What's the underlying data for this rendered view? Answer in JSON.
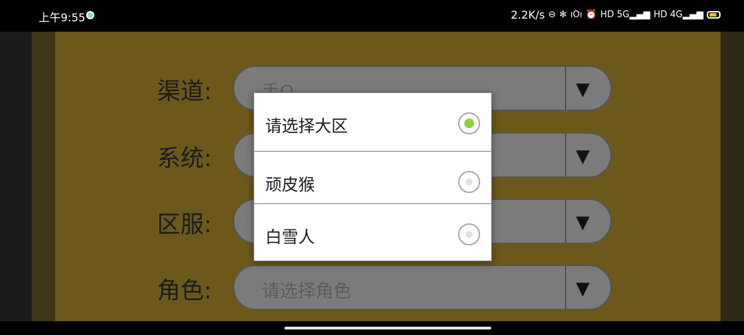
{
  "status_bar": {
    "time": "上午9:55",
    "net_speed": "2.2K/s",
    "icons": [
      "dnd-icon",
      "bluetooth-icon",
      "vibrate-icon",
      "alarm-icon",
      "hd-5g-signal-icon",
      "hd-4g-signal-icon",
      "battery-icon"
    ],
    "icon_glyphs": {
      "dnd": "⊖",
      "bluetooth": "✻",
      "vibrate": "ıOı",
      "alarm": "⏰",
      "sig1": "HD 5G▂▄▆",
      "sig2": "HD 4G▂▄▆"
    },
    "battery_color": "#f2c200"
  },
  "form": {
    "rows": [
      {
        "label": "渠道:",
        "value": "手Q"
      },
      {
        "label": "系统:",
        "value": ""
      },
      {
        "label": "区服:",
        "value": ""
      },
      {
        "label": "角色:",
        "value": "请选择角色"
      }
    ],
    "arrow_glyph": "▼"
  },
  "dialog": {
    "options": [
      {
        "label": "请选择大区",
        "checked": true
      },
      {
        "label": "顽皮猴",
        "checked": false
      },
      {
        "label": "白雪人",
        "checked": false
      }
    ],
    "checked_color": "#8bd43c"
  },
  "colors": {
    "panel": "#6d581b",
    "select_bg": "#7b7b7b"
  }
}
